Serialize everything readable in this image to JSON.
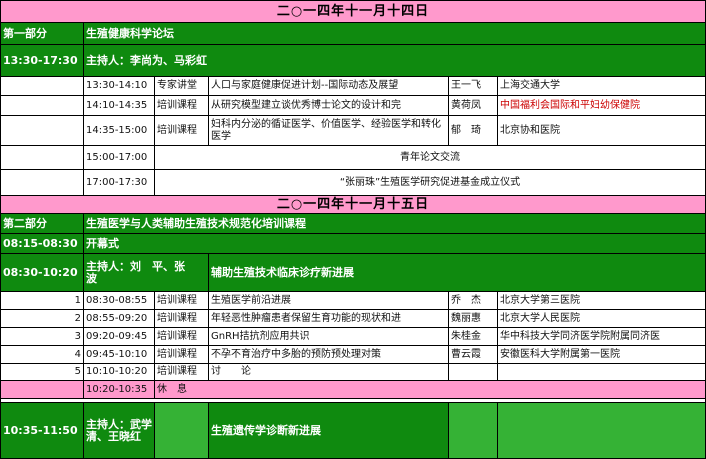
{
  "day1": {
    "date": "二○一四年十一月十四日",
    "part_label": "第一部分",
    "part_title": "生殖健康科学论坛",
    "session_time": "13:30-17:30",
    "host": "主持人：李尚为、马彩虹",
    "rows": [
      {
        "time": "13:30-14:10",
        "type": "专家讲堂",
        "topic": "人口与家庭健康促进计划--国际动态及展望",
        "speaker": "王一飞",
        "org": "上海交通大学"
      },
      {
        "time": "14:10-14:35",
        "type": "培训课程",
        "topic": "从研究模型建立谈优秀博士论文的设计和完",
        "speaker": "黄荷凤",
        "org": "中国福利会国际和平妇幼保健院"
      },
      {
        "time": "14:35-15:00",
        "type": "培训课程",
        "topic": "妇科内分泌的循证医学、价值医学、经验医学和转化医学",
        "speaker": "郁　琦",
        "org": "北京协和医院"
      }
    ],
    "events": [
      {
        "time": "15:00-17:00",
        "title": "青年论文交流"
      },
      {
        "time": "17:00-17:30",
        "title": "“张丽珠”生殖医学研究促进基金成立仪式"
      }
    ]
  },
  "day2": {
    "date": "二○一四年十一月十五日",
    "part_label": "第二部分",
    "part_title": "生殖医学与人类辅助生殖技术规范化培训课程",
    "opening_time": "08:15-08:30",
    "opening_title": "开幕式",
    "session1": {
      "time": "08:30-10:20",
      "host": "主持人：刘　平、张　波",
      "title": "辅助生殖技术临床诊疗新进展",
      "rows": [
        {
          "no": "1",
          "time": "08:30-08:55",
          "type": "培训课程",
          "topic": "生殖医学前沿进展",
          "speaker": "乔　杰",
          "org": "北京大学第三医院"
        },
        {
          "no": "2",
          "time": "08:55-09:20",
          "type": "培训课程",
          "topic": "年轻恶性肿瘤患者保留生育功能的现状和进",
          "speaker": "魏丽惠",
          "org": "北京大学人民医院"
        },
        {
          "no": "3",
          "time": "09:20-09:45",
          "type": "培训课程",
          "topic": "GnRH拮抗剂应用共识",
          "speaker": "朱桂金",
          "org": "华中科技大学同济医学院附属同济医"
        },
        {
          "no": "4",
          "time": "09:45-10:10",
          "type": "培训课程",
          "topic": "不孕不育治疗中多胎的预防预处理对策",
          "speaker": "曹云霞",
          "org": "安徽医科大学附属第一医院"
        },
        {
          "no": "5",
          "time": "10:10-10:20",
          "type": "培训课程",
          "topic": "讨　　论",
          "speaker": "",
          "org": ""
        }
      ]
    },
    "break": {
      "time": "10:20-10:35",
      "title": "休　息"
    },
    "session2": {
      "time": "10:35-11:50",
      "host": "主持人：武学清、王晓红",
      "title": "生殖遗传学诊断新进展"
    }
  }
}
